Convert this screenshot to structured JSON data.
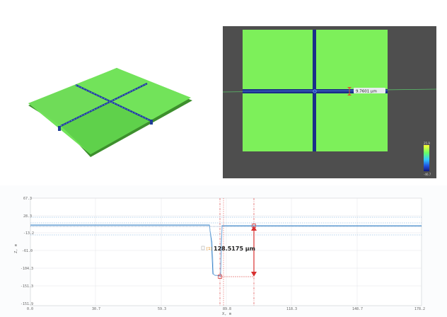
{
  "heightmap": {
    "measurement_label": "9.7601 µm",
    "scale_max": "25.9",
    "scale_min": "-46.7"
  },
  "profile": {
    "readout": {
      "index": "[1]",
      "value": "128.5175 µm"
    },
    "x_axis": {
      "title": "X, m",
      "ticks": [
        "0.0",
        "30.7",
        "59.3",
        "89.8",
        "118.3",
        "148.7",
        "178.2"
      ]
    },
    "y_axis": {
      "title": "Z, m",
      "ticks": [
        "67.3",
        "28.3",
        "-13.2",
        "-61.0",
        "-104.3",
        "-151.3",
        "-151.9"
      ]
    }
  },
  "colors": {
    "surface_green": "#7df05a",
    "trench_blue": "#1a2f8a",
    "viewport_gray": "#4e4e4e",
    "cursor_red": "#d8302f",
    "profile_line": "#3a84c9"
  }
}
